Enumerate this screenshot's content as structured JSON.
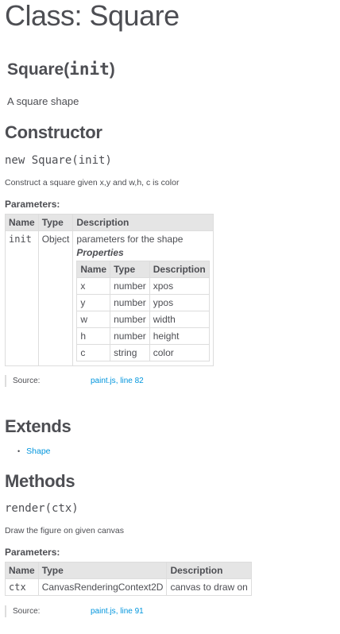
{
  "page": {
    "title": "Class: Square"
  },
  "class": {
    "name": "Square",
    "sig_open": "(",
    "arg": "init",
    "sig_close": ")",
    "description": "A square shape"
  },
  "constructor": {
    "heading": "Constructor",
    "signature": "new Square(init)",
    "description": "Construct a square given x,y and w,h, c is color",
    "params_heading": "Parameters:",
    "table_headers": [
      "Name",
      "Type",
      "Description"
    ],
    "param": {
      "name": "init",
      "type": "Object",
      "description": "parameters for the shape",
      "properties_label": "Properties",
      "properties_headers": [
        "Name",
        "Type",
        "Description"
      ],
      "properties": [
        {
          "name": "x",
          "type": "number",
          "description": "xpos"
        },
        {
          "name": "y",
          "type": "number",
          "description": "ypos"
        },
        {
          "name": "w",
          "type": "number",
          "description": "width"
        },
        {
          "name": "h",
          "type": "number",
          "description": "height"
        },
        {
          "name": "c",
          "type": "string",
          "description": "color"
        }
      ]
    },
    "source_label": "Source:",
    "source_file": "paint.js",
    "source_sep": ", ",
    "source_line": "line 82"
  },
  "extends": {
    "heading": "Extends",
    "items": [
      "Shape"
    ]
  },
  "methods": {
    "heading": "Methods",
    "signature": "render(ctx)",
    "description": "Draw the figure on given canvas",
    "params_heading": "Parameters:",
    "table_headers": [
      "Name",
      "Type",
      "Description"
    ],
    "params": [
      {
        "name": "ctx",
        "type": "CanvasRenderingContext2D",
        "description": "canvas to draw on"
      }
    ],
    "source_label": "Source:",
    "source_file": "paint.js",
    "source_sep": ", ",
    "source_line": "line 91"
  },
  "colors": {
    "text": "#4d4e53",
    "link": "#0095dd",
    "header_bg": "#e5e5e5",
    "border": "#dddddd"
  }
}
